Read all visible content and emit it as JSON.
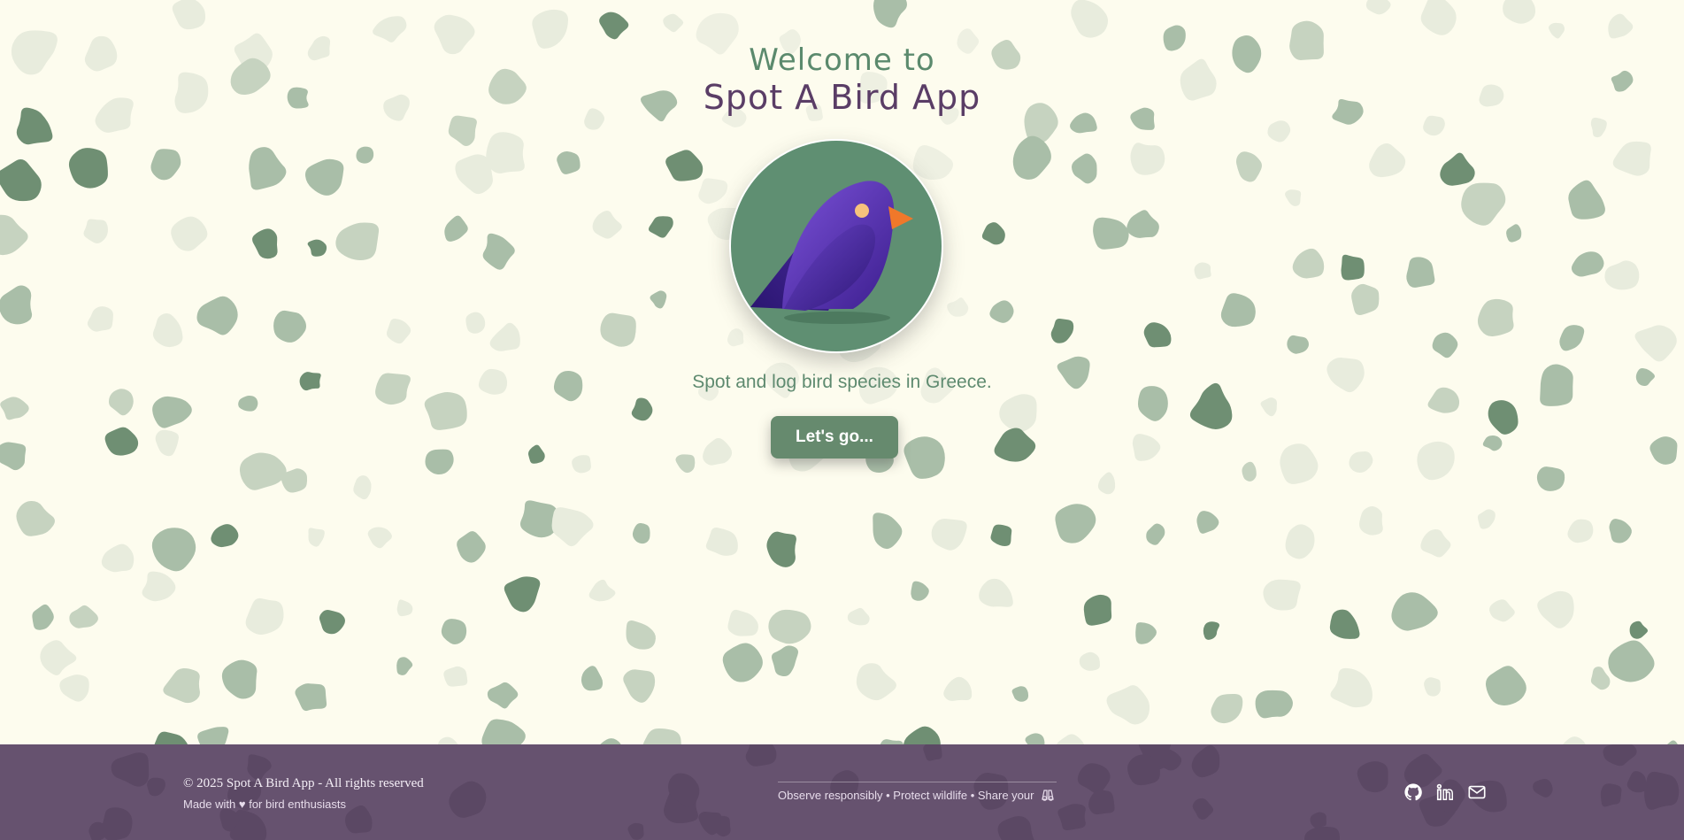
{
  "hero": {
    "title_line1": "Welcome to",
    "title_line2": "Spot A Bird App",
    "logo_icon": "bird-icon",
    "tagline": "Spot and log bird species in Greece.",
    "cta_label": "Let's go..."
  },
  "footer": {
    "copyright": "© 2025 Spot A Bird App - All rights reserved",
    "made_with": "Made with ♥ for bird enthusiasts",
    "motto": "Observe responsibly • Protect wildlife • Share your",
    "motto_icon": "binoculars-icon",
    "social": [
      {
        "name": "github-icon",
        "label": "GitHub"
      },
      {
        "name": "linkedin-icon",
        "label": "LinkedIn"
      },
      {
        "name": "mail-icon",
        "label": "Email"
      }
    ]
  },
  "colors": {
    "background": "#fdfcee",
    "title_green": "#5b8a6d",
    "title_purple": "#5a3d66",
    "circle_green": "#5f8f72",
    "button_green": "#668a6e",
    "footer_purple": "#66526f",
    "bird_purple": "#5a32b8",
    "beak_orange": "#f0782a"
  }
}
